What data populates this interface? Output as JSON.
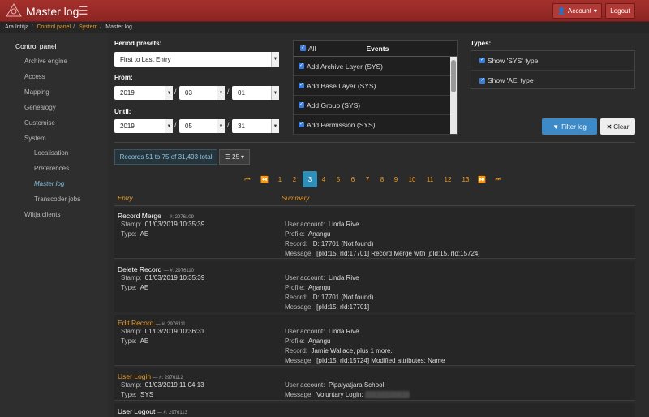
{
  "header": {
    "title": "Master log",
    "account_label": "Account",
    "logout_label": "Logout"
  },
  "breadcrumb": {
    "root": "Ara Irititja",
    "control_panel": "Control panel",
    "system": "System",
    "current": "Master log"
  },
  "sidebar": {
    "heading": "Control panel",
    "items": [
      "Archive engine",
      "Access",
      "Mapping",
      "Genealogy",
      "Customise",
      "System"
    ],
    "sub_items": [
      "Localisation",
      "Preferences",
      "Master log",
      "Transcoder jobs"
    ],
    "last_item": "Wiltja clients"
  },
  "filters": {
    "presets_label": "Period presets:",
    "preset_value": "First to Last Entry",
    "from_label": "From:",
    "from": {
      "year": "2019",
      "month": "03",
      "day": "01"
    },
    "until_label": "Until:",
    "until": {
      "year": "2019",
      "month": "05",
      "day": "31"
    },
    "slash": "/"
  },
  "events": {
    "all_label": "All",
    "header": "Events",
    "items": [
      "Add Archive Layer (SYS)",
      "Add Base Layer (SYS)",
      "Add Group (SYS)",
      "Add Permission (SYS)"
    ]
  },
  "types": {
    "label": "Types:",
    "items": [
      "Show 'SYS' type",
      "Show 'AE' type"
    ]
  },
  "actions": {
    "filter": "Filter log",
    "clear": "Clear"
  },
  "records": {
    "summary": "Records 51 to 75 of 31,493 total",
    "page_size": "25"
  },
  "pagination": {
    "first": "⏮",
    "prev": "⏪",
    "pages": [
      "1",
      "2",
      "3",
      "4",
      "5",
      "6",
      "7",
      "8",
      "9",
      "10",
      "11",
      "12",
      "13"
    ],
    "next": "⏩",
    "last": "⏭",
    "current": "3"
  },
  "columns": {
    "entry": "Entry",
    "summary": "Summary"
  },
  "entries": [
    {
      "title": "Record Merge",
      "id": "— #: 2976109",
      "stamp_label": "Stamp:",
      "stamp": "01/03/2019 10:35:39",
      "type_label": "Type:",
      "type": "AE",
      "account_label": "User account:",
      "account": "Linda Rive",
      "profile_label": "Profile:",
      "profile": "Aṉangu",
      "record_label": "Record:",
      "record": "ID: 17701 (Not found)",
      "message_label": "Message:",
      "message": "[pId:15, rId:17701] Record Merge with [pId:15, rId:15724]"
    },
    {
      "title": "Delete Record",
      "id": "— #: 2976110",
      "stamp_label": "Stamp:",
      "stamp": "01/03/2019 10:35:39",
      "type_label": "Type:",
      "type": "AE",
      "account_label": "User account:",
      "account": "Linda Rive",
      "profile_label": "Profile:",
      "profile": "Aṉangu",
      "record_label": "Record:",
      "record": "ID: 17701 (Not found)",
      "message_label": "Message:",
      "message": "[pId:15, rId:17701]"
    },
    {
      "title": "Edit Record",
      "id": "— #: 2976111",
      "stamp_label": "Stamp:",
      "stamp": "01/03/2019 10:36:31",
      "type_label": "Type:",
      "type": "AE",
      "account_label": "User account:",
      "account": "Linda Rive",
      "profile_label": "Profile:",
      "profile": "Aṉangu",
      "record_label": "Record:",
      "record": "Jamie Wallace, plus 1 more.",
      "message_label": "Message:",
      "message": "[pId:15, rId:15724] Modified attributes: Name"
    },
    {
      "title": "User Login",
      "id": "— #: 2976112",
      "stamp_label": "Stamp:",
      "stamp": "01/03/2019 11:04:13",
      "type_label": "Type:",
      "type": "SYS",
      "account_label": "User account:",
      "account": "Pipalyatjara School",
      "message_label": "Message:",
      "message": "Voluntary Login:",
      "message_ip": "203.122.204.16"
    },
    {
      "title": "User Logout",
      "id": "— #: 2976113"
    }
  ]
}
